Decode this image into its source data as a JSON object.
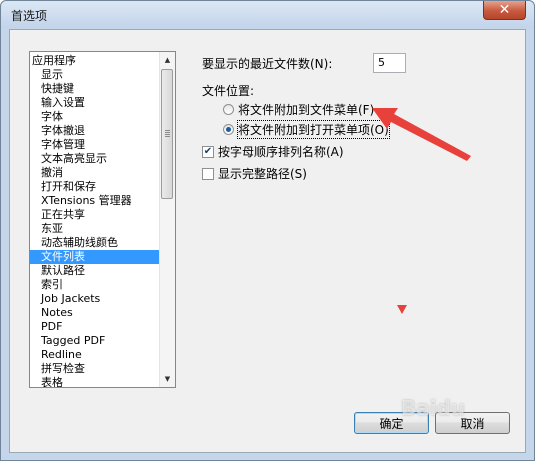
{
  "window": {
    "title": "首选项",
    "close_glyph": "✕"
  },
  "category_list": {
    "items": [
      {
        "label": "应用程序",
        "level": 0
      },
      {
        "label": "显示",
        "level": 1
      },
      {
        "label": "快捷键",
        "level": 1
      },
      {
        "label": "输入设置",
        "level": 1
      },
      {
        "label": "字体",
        "level": 1
      },
      {
        "label": "字体撤退",
        "level": 1
      },
      {
        "label": "字体管理",
        "level": 1
      },
      {
        "label": "文本高亮显示",
        "level": 1
      },
      {
        "label": "撤消",
        "level": 1
      },
      {
        "label": "打开和保存",
        "level": 1
      },
      {
        "label": "XTensions 管理器",
        "level": 1
      },
      {
        "label": "正在共享",
        "level": 1
      },
      {
        "label": "东亚",
        "level": 1
      },
      {
        "label": "动态辅助线颜色",
        "level": 1
      },
      {
        "label": "文件列表",
        "level": 1,
        "selected": true
      },
      {
        "label": "默认路径",
        "level": 1
      },
      {
        "label": "索引",
        "level": 1
      },
      {
        "label": "Job Jackets",
        "level": 1
      },
      {
        "label": "Notes",
        "level": 1
      },
      {
        "label": "PDF",
        "level": 1
      },
      {
        "label": "Tagged PDF",
        "level": 1
      },
      {
        "label": "Redline",
        "level": 1
      },
      {
        "label": "拼写检查",
        "level": 1
      },
      {
        "label": "表格",
        "level": 1
      }
    ]
  },
  "settings": {
    "recent_files_label": "要显示的最近文件数(N):",
    "recent_files_value": "5",
    "file_location_label": "文件位置:",
    "radio_options": [
      {
        "label": "将文件附加到文件菜单(F)",
        "checked": false
      },
      {
        "label": "将文件附加到打开菜单项(O)",
        "checked": true
      }
    ],
    "checkboxes": [
      {
        "label": "按字母顺序排列名称(A)",
        "checked": true
      },
      {
        "label": "显示完整路径(S)",
        "checked": false
      }
    ]
  },
  "buttons": {
    "ok": "确定",
    "cancel": "取消"
  },
  "watermark": "Baidu",
  "colors": {
    "selection": "#3399ff",
    "arrow": "#e8403a"
  }
}
